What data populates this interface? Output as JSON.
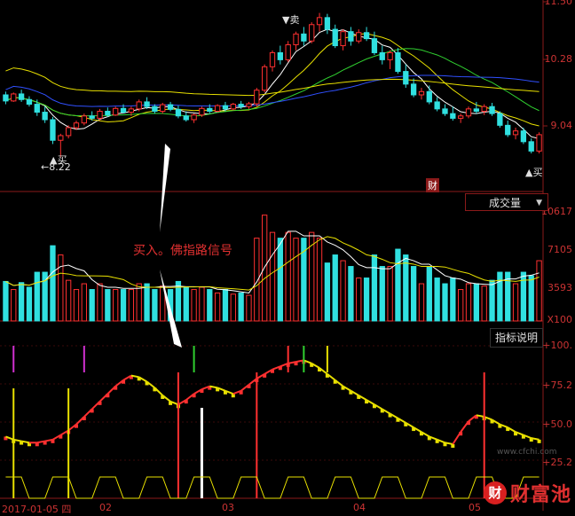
{
  "top_axis_label": "11.50",
  "price_labels": [
    "10.28",
    "9.04"
  ],
  "vol_labels": [
    "10617",
    "7105",
    "3593",
    "X100"
  ],
  "ind_labels": [
    "+100.",
    "+75.2",
    "+50.0",
    "+25.2"
  ],
  "date_labels": [
    "2017-01-05 四",
    "02",
    "03",
    "04",
    "05"
  ],
  "buttons": {
    "volume": "成交量",
    "indicator": "指标说明"
  },
  "annotations": {
    "signal": "买入。佛指路信号",
    "low": "←8.22",
    "buy1": "▲买",
    "sell": "▼卖",
    "buy2": "▲买",
    "finance": "财"
  },
  "watermark": {
    "icon": "财",
    "text": "财富池",
    "url": "www.cfchi.com"
  },
  "colors": {
    "up": "#ff3030",
    "down": "#30e0e0",
    "ma1": "#ffffff",
    "ma2": "#e8e000",
    "ma3": "#d030d0",
    "ma4": "#30d030",
    "ma5": "#3050ff",
    "grid": "#8b1a1a"
  },
  "chart_data": {
    "type": "candlestick",
    "price_range": [
      7.6,
      11.5
    ],
    "volume_range": [
      0,
      11000
    ],
    "indicator_range": [
      0,
      100
    ],
    "candles": [
      [
        9.55,
        9.62,
        9.35,
        9.42
      ],
      [
        9.42,
        9.6,
        9.4,
        9.57
      ],
      [
        9.57,
        9.66,
        9.4,
        9.45
      ],
      [
        9.45,
        9.52,
        9.3,
        9.35
      ],
      [
        9.35,
        9.45,
        9.1,
        9.18
      ],
      [
        9.18,
        9.3,
        8.95,
        9.02
      ],
      [
        9.02,
        9.08,
        8.5,
        8.58
      ],
      [
        8.58,
        8.72,
        8.22,
        8.68
      ],
      [
        8.68,
        8.9,
        8.62,
        8.85
      ],
      [
        8.85,
        9.0,
        8.8,
        8.95
      ],
      [
        8.95,
        9.15,
        8.9,
        9.1
      ],
      [
        9.1,
        9.2,
        9.0,
        9.05
      ],
      [
        9.05,
        9.25,
        9.0,
        9.2
      ],
      [
        9.2,
        9.28,
        9.08,
        9.12
      ],
      [
        9.12,
        9.3,
        9.1,
        9.26
      ],
      [
        9.26,
        9.35,
        9.15,
        9.18
      ],
      [
        9.18,
        9.3,
        9.1,
        9.25
      ],
      [
        9.25,
        9.45,
        9.2,
        9.4
      ],
      [
        9.4,
        9.5,
        9.25,
        9.3
      ],
      [
        9.3,
        9.35,
        9.15,
        9.2
      ],
      [
        9.2,
        9.38,
        9.15,
        9.34
      ],
      [
        9.34,
        9.4,
        9.2,
        9.24
      ],
      [
        9.24,
        9.32,
        9.05,
        9.1
      ],
      [
        9.1,
        9.2,
        8.98,
        9.02
      ],
      [
        9.02,
        9.15,
        8.95,
        9.12
      ],
      [
        9.12,
        9.3,
        9.08,
        9.26
      ],
      [
        9.26,
        9.35,
        9.15,
        9.2
      ],
      [
        9.2,
        9.35,
        9.18,
        9.32
      ],
      [
        9.32,
        9.4,
        9.2,
        9.25
      ],
      [
        9.25,
        9.38,
        9.22,
        9.35
      ],
      [
        9.35,
        9.42,
        9.25,
        9.3
      ],
      [
        9.3,
        9.4,
        9.25,
        9.36
      ],
      [
        9.36,
        9.7,
        9.3,
        9.65
      ],
      [
        9.65,
        10.2,
        9.6,
        10.15
      ],
      [
        10.15,
        10.5,
        10.05,
        10.45
      ],
      [
        10.45,
        10.6,
        10.2,
        10.3
      ],
      [
        10.3,
        10.7,
        10.25,
        10.62
      ],
      [
        10.62,
        10.9,
        10.5,
        10.85
      ],
      [
        10.85,
        11.0,
        10.6,
        10.7
      ],
      [
        10.7,
        11.1,
        10.65,
        11.05
      ],
      [
        11.05,
        11.3,
        10.9,
        11.2
      ],
      [
        11.2,
        11.28,
        10.85,
        10.95
      ],
      [
        10.95,
        11.05,
        10.55,
        10.6
      ],
      [
        10.6,
        10.95,
        10.5,
        10.9
      ],
      [
        10.9,
        11.0,
        10.6,
        10.7
      ],
      [
        10.7,
        10.95,
        10.65,
        10.88
      ],
      [
        10.88,
        11.0,
        10.7,
        10.75
      ],
      [
        10.75,
        10.9,
        10.4,
        10.45
      ],
      [
        10.45,
        10.6,
        10.2,
        10.3
      ],
      [
        10.3,
        10.5,
        10.1,
        10.45
      ],
      [
        10.45,
        10.55,
        10.0,
        10.05
      ],
      [
        10.05,
        10.2,
        9.7,
        9.78
      ],
      [
        9.78,
        9.9,
        9.5,
        9.55
      ],
      [
        9.55,
        9.7,
        9.45,
        9.62
      ],
      [
        9.62,
        9.75,
        9.35,
        9.4
      ],
      [
        9.4,
        9.5,
        9.2,
        9.25
      ],
      [
        9.25,
        9.35,
        9.1,
        9.15
      ],
      [
        9.15,
        9.3,
        9.0,
        9.05
      ],
      [
        9.05,
        9.15,
        8.95,
        9.1
      ],
      [
        9.1,
        9.3,
        9.05,
        9.25
      ],
      [
        9.25,
        9.4,
        9.15,
        9.2
      ],
      [
        9.2,
        9.35,
        9.12,
        9.3
      ],
      [
        9.3,
        9.38,
        9.1,
        9.15
      ],
      [
        9.15,
        9.2,
        8.85,
        8.9
      ],
      [
        8.9,
        9.0,
        8.65,
        8.7
      ],
      [
        8.7,
        8.85,
        8.6,
        8.78
      ],
      [
        8.78,
        8.85,
        8.5,
        8.55
      ],
      [
        8.55,
        8.62,
        8.3,
        8.35
      ],
      [
        8.35,
        8.75,
        8.3,
        8.7
      ]
    ],
    "indicator": [
      30,
      28,
      27,
      26,
      26,
      27,
      28,
      31,
      34,
      38,
      43,
      48,
      53,
      58,
      63,
      67,
      70,
      69,
      66,
      62,
      57,
      53,
      51,
      54,
      58,
      61,
      63,
      62,
      60,
      58,
      60,
      64,
      68,
      71,
      74,
      76,
      78,
      79,
      80,
      78,
      75,
      71,
      67,
      63,
      60,
      57,
      54,
      51,
      48,
      45,
      42,
      39,
      36,
      33,
      30,
      28,
      26,
      25,
      33,
      40,
      44,
      43,
      41,
      38,
      36,
      33,
      31,
      29,
      28
    ]
  }
}
